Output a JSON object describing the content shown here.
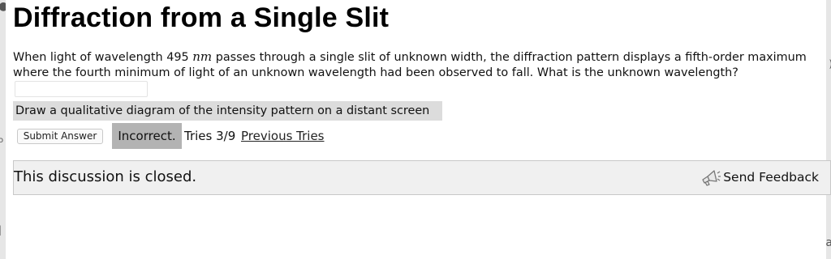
{
  "page": {
    "title": "Diffraction from a Single Slit"
  },
  "question": {
    "text_part1": "When light of wavelength 495 ",
    "unit": "nm",
    "text_part2": " passes through a single slit of unknown width, the diffraction pattern displays a fifth-order maximum where the fourth minimum of light of an unknown wavelength had been observed to fall. What is the unknown wavelength?"
  },
  "answer": {
    "value": "",
    "placeholder": ""
  },
  "hint": {
    "text": "Draw a qualitative diagram of the intensity pattern on a distant screen"
  },
  "controls": {
    "submit_label": "Submit Answer",
    "status": "Incorrect.",
    "tries": "Tries 3/9",
    "previous_tries_label": "Previous Tries"
  },
  "discussion": {
    "closed_text": "This discussion is closed.",
    "feedback_label": "Send Feedback",
    "feedback_icon": "megaphone-icon"
  },
  "colors": {
    "hint_bg": "#dcdcdc",
    "status_bg": "#b3b3b3",
    "discussion_bg": "#f0f0f0"
  }
}
